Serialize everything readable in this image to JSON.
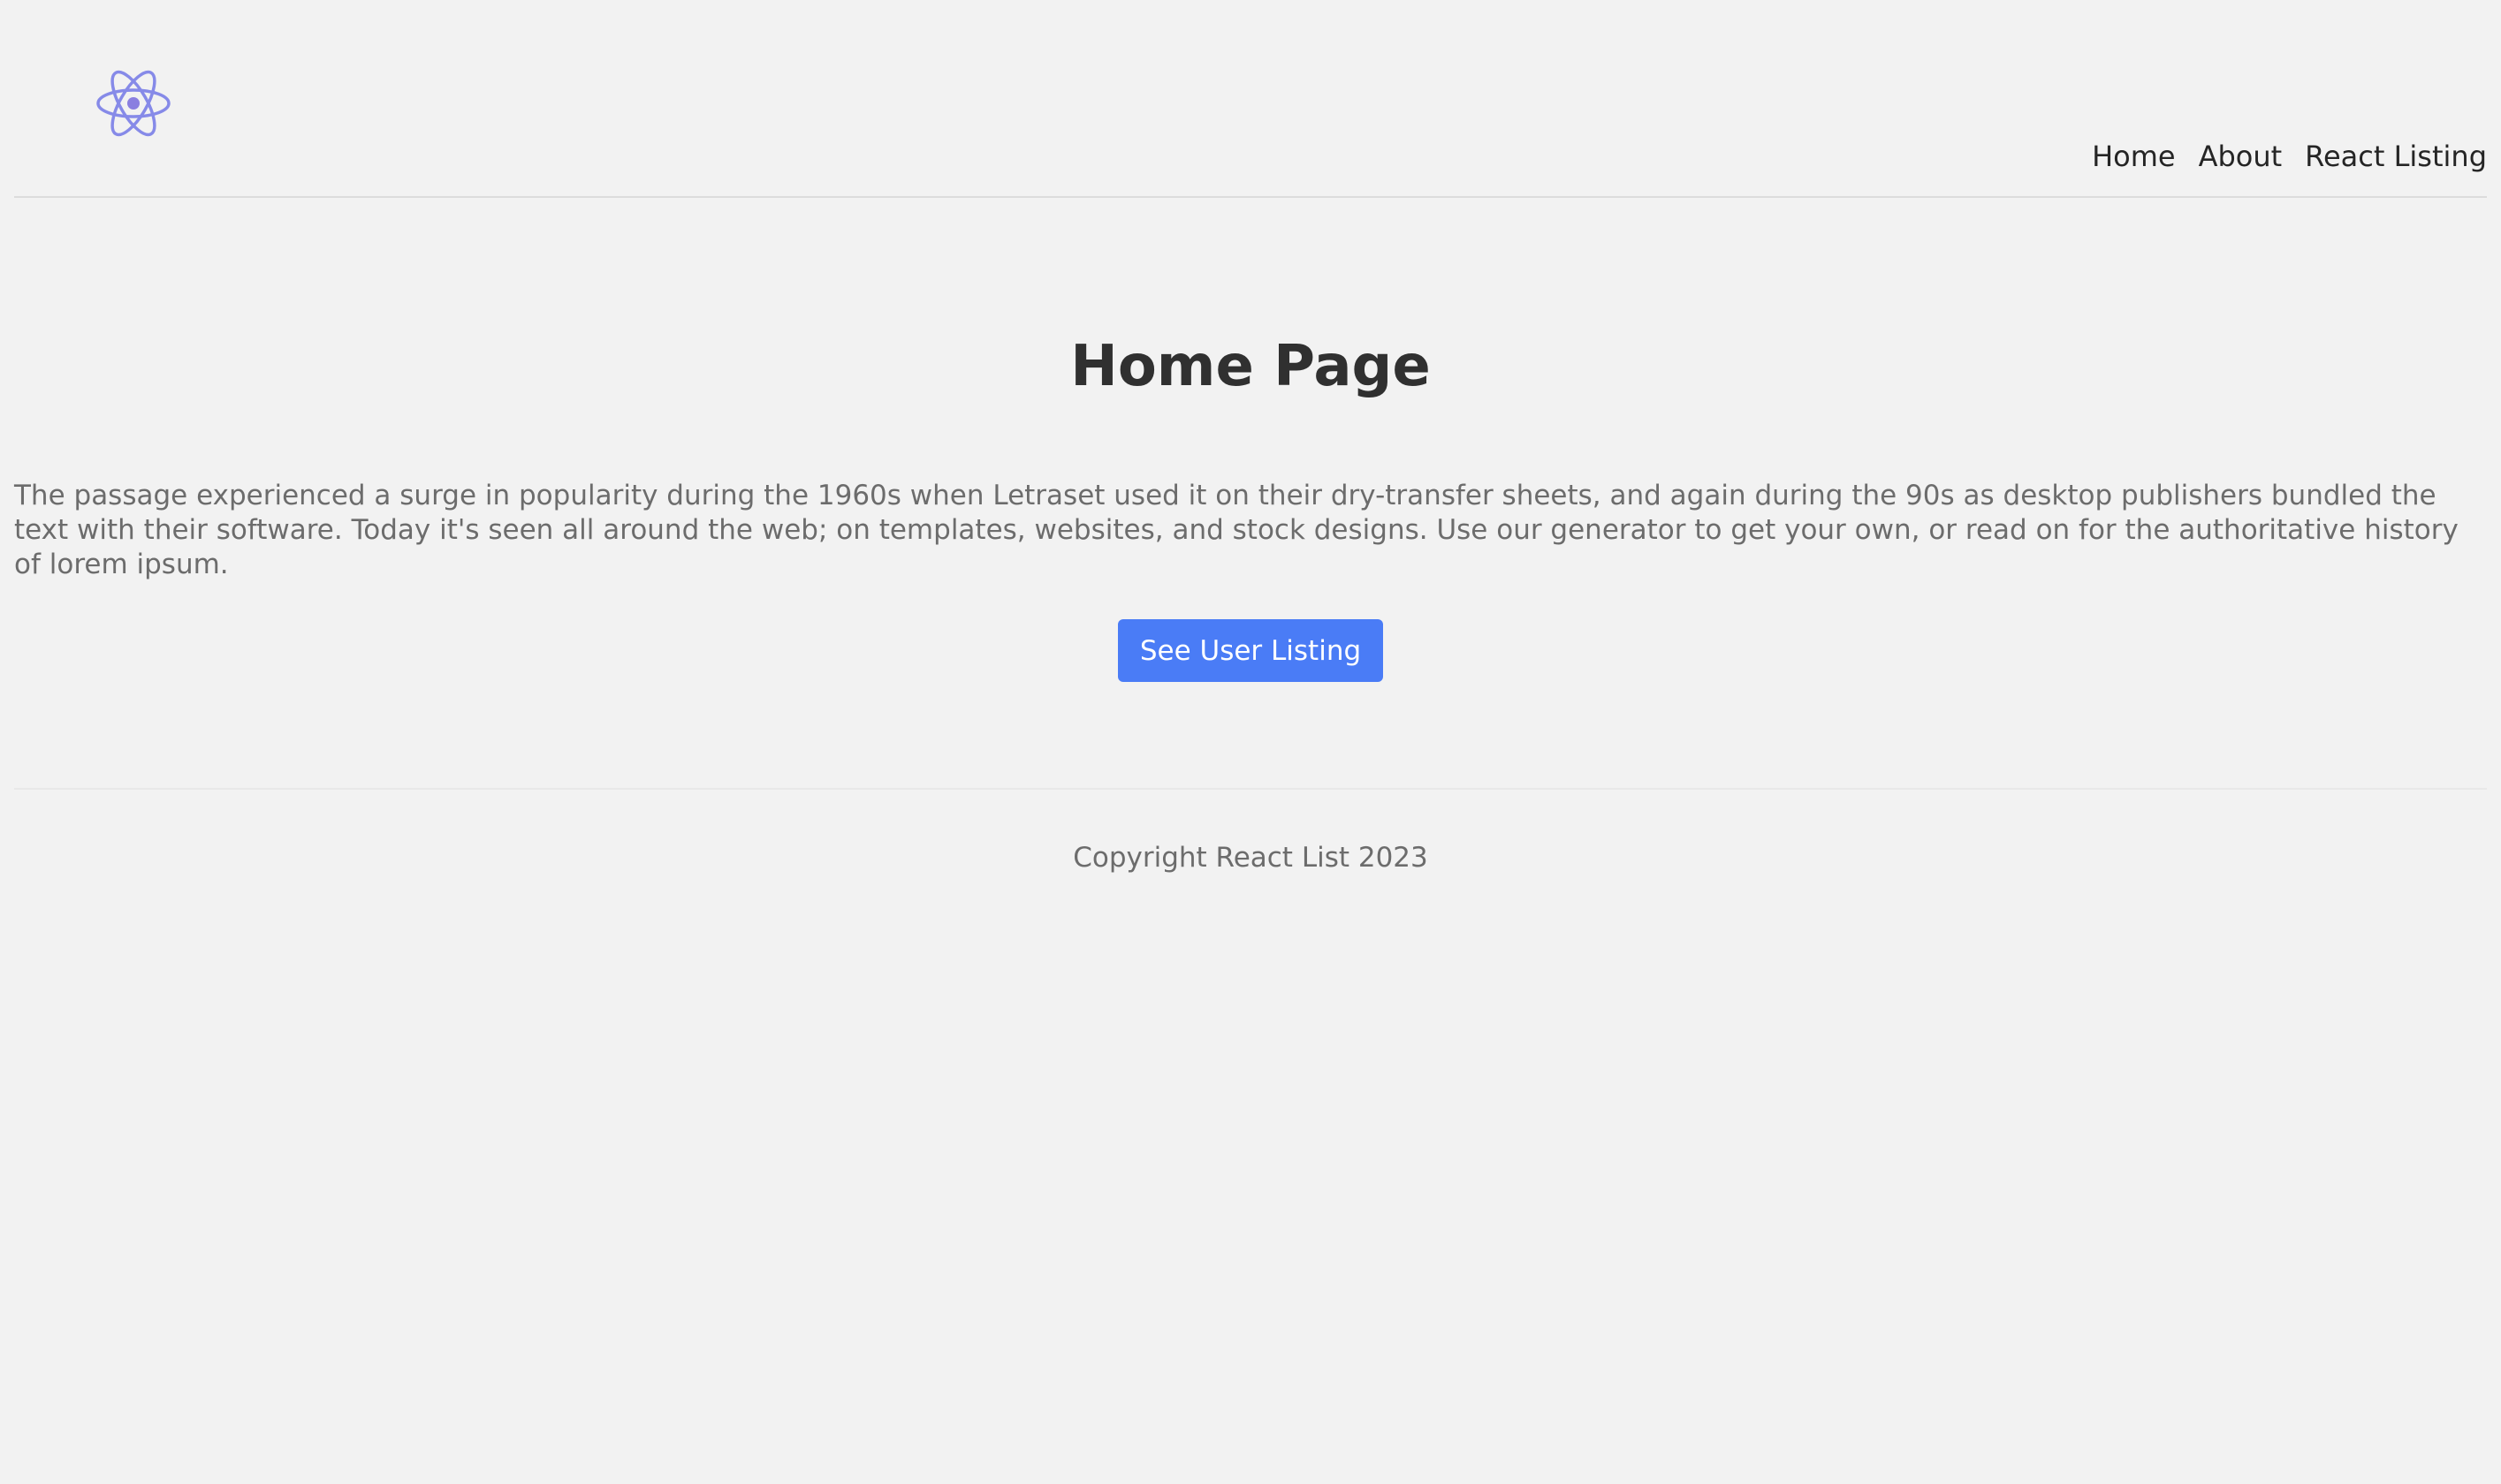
{
  "header": {
    "logo_icon": "react-atom-icon",
    "nav": [
      {
        "label": "Home"
      },
      {
        "label": "About"
      },
      {
        "label": "React Listing"
      }
    ]
  },
  "main": {
    "title": "Home Page",
    "paragraph": "The passage experienced a surge in popularity during the 1960s when Letraset used it on their dry-transfer sheets, and again during the 90s as desktop publishers bundled the text with their software. Today it's seen all around the web; on templates, websites, and stock designs. Use our generator to get your own, or read on for the authoritative history of lorem ipsum.",
    "cta_label": "See User Listing"
  },
  "footer": {
    "copyright": "Copyright React List 2023"
  },
  "colors": {
    "background": "#f2f2f2",
    "accent": "#4a7cf6",
    "logo": "#7b7fe8"
  }
}
